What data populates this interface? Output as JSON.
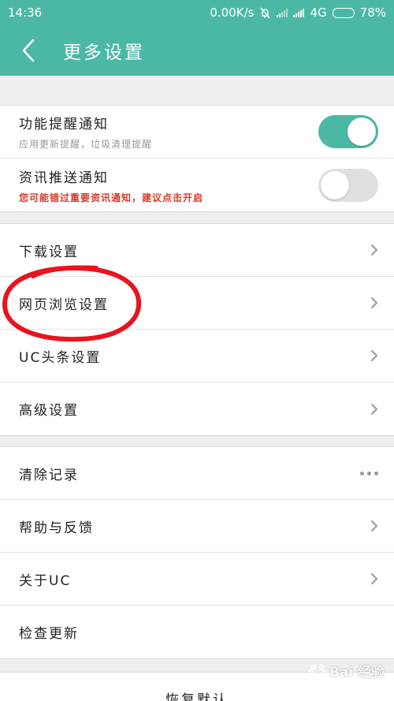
{
  "status_bar": {
    "time": "14:36",
    "speed": "0.00K/s",
    "network": "4G",
    "battery": "78%",
    "battery_level": 0.78
  },
  "header": {
    "title": "更多设置"
  },
  "notifications": [
    {
      "label": "功能提醒通知",
      "sub": "应用更新提醒，垃圾清理提醒",
      "enabled": true
    },
    {
      "label": "资讯推送通知",
      "sub": "您可能错过重要资讯通知，建议点击开启",
      "enabled": false
    }
  ],
  "settings_group": [
    {
      "label": "下载设置"
    },
    {
      "label": "网页浏览设置"
    },
    {
      "label": "UC头条设置"
    },
    {
      "label": "高级设置"
    }
  ],
  "misc_group": [
    {
      "label": "清除记录"
    },
    {
      "label": "帮助与反馈"
    },
    {
      "label": "关于UC"
    },
    {
      "label": "检查更新"
    }
  ],
  "restore_label": "恢复默认",
  "colors": {
    "accent": "#4bb8a5",
    "warning": "#d93a2a",
    "annotation": "#e8141e"
  },
  "watermark": {
    "text": "Bai 经验",
    "icon": "baidu-paw-icon"
  }
}
